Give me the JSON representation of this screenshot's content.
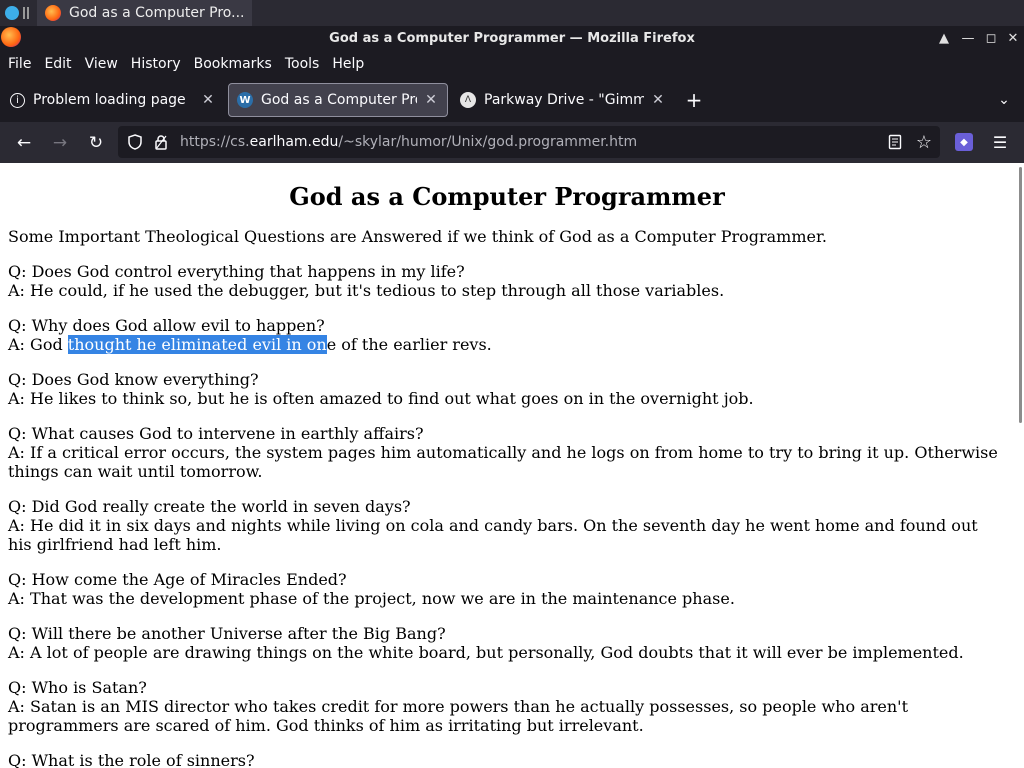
{
  "taskbar": {
    "window_label": "God as a Computer Pro..."
  },
  "window": {
    "title": "God as a Computer Programmer — Mozilla Firefox",
    "controls": [
      "▲",
      "—",
      "◻",
      "✕"
    ]
  },
  "menu": {
    "items": [
      "File",
      "Edit",
      "View",
      "History",
      "Bookmarks",
      "Tools",
      "Help"
    ]
  },
  "tabs": [
    {
      "label": "Problem loading page",
      "active": false,
      "icon": "info-icon"
    },
    {
      "label": "God as a Computer Progr",
      "active": true,
      "icon": "wordpress-icon"
    },
    {
      "label": "Parkway Drive - \"Gimme",
      "active": false,
      "icon": "site-icon"
    }
  ],
  "toolbar": {
    "new_tab": "+",
    "tab_list": "⌄",
    "back": "←",
    "forward": "→",
    "reload": "↻"
  },
  "url": {
    "prefix": "https://cs.",
    "host": "earlham.edu",
    "path": "/~skylar/humor/Unix/god.programmer.htm"
  },
  "page": {
    "heading": "God as a Computer Programmer",
    "intro": "Some Important Theological Questions are Answered if we think of God as a Computer Programmer.",
    "qa": [
      {
        "q": "Q: Does God control everything that happens in my life?",
        "a": "A: He could, if he used the debugger, but it's tedious to step through all those variables."
      },
      {
        "q": "Q: Why does God allow evil to happen?",
        "a_before": "A: God ",
        "a_selected": "thought he eliminated evil in on",
        "a_after": "e of the earlier revs."
      },
      {
        "q": "Q: Does God know everything?",
        "a": "A: He likes to think so, but he is often amazed to find out what goes on in the overnight job."
      },
      {
        "q": "Q: What causes God to intervene in earthly affairs?",
        "a": "A: If a critical error occurs, the system pages him automatically and he logs on from home to try to bring it up. Otherwise things can wait until tomorrow."
      },
      {
        "q": "Q: Did God really create the world in seven days?",
        "a": "A: He did it in six days and nights while living on cola and candy bars. On the seventh day he went home and found out his girlfriend had left him."
      },
      {
        "q": "Q: How come the Age of Miracles Ended?",
        "a": "A: That was the development phase of the project, now we are in the maintenance phase."
      },
      {
        "q": "Q: Will there be another Universe after the Big Bang?",
        "a": "A: A lot of people are drawing things on the white board, but personally, God doubts that it will ever be implemented."
      },
      {
        "q": "Q: Who is Satan?",
        "a": "A: Satan is an MIS director who takes credit for more powers than he actually possesses, so people who aren't programmers are scared of him. God thinks of him as irritating but irrelevant."
      },
      {
        "q": "Q: What is the role of sinners?",
        "a": ""
      }
    ]
  }
}
